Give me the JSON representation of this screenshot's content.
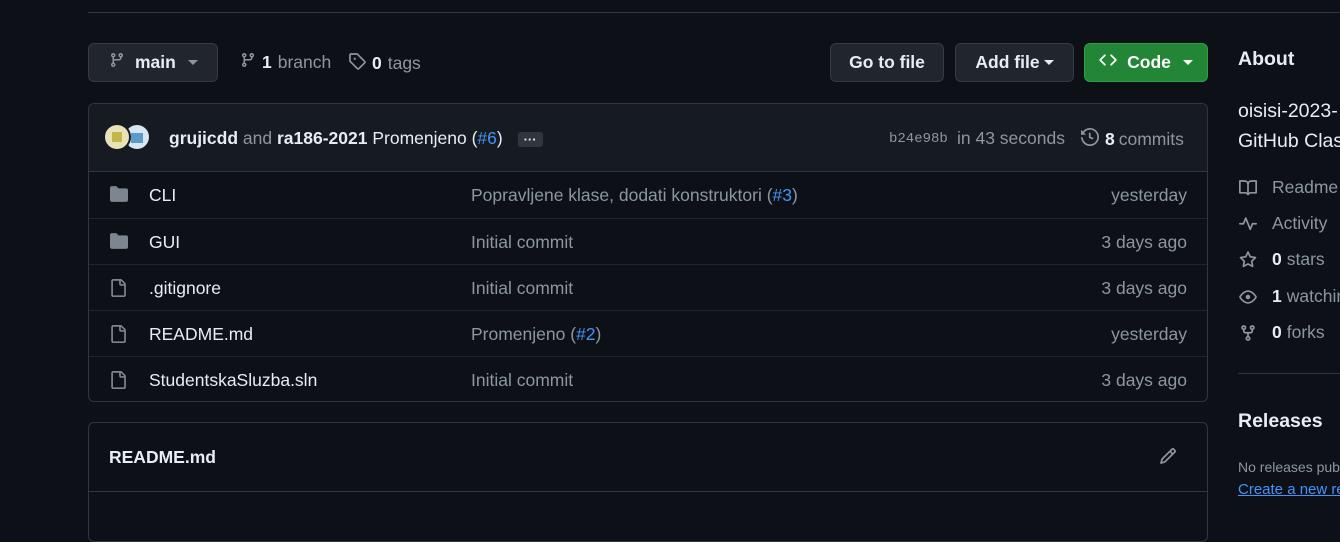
{
  "toolbar": {
    "branch": "main",
    "branches_count": "1",
    "branches_label": "branch",
    "tags_count": "0",
    "tags_label": "tags",
    "go_to_file": "Go to file",
    "add_file": "Add file",
    "code": "Code"
  },
  "commit": {
    "author1": "grujicdd",
    "and": "and",
    "author2": "ra186-2021",
    "message": "Promenjeno (",
    "pr": "#6",
    "message_end": ")",
    "more": "···",
    "sha": "b24e98b",
    "time": "in 43 seconds",
    "commits_count": "8",
    "commits_label": "commits"
  },
  "files": [
    {
      "type": "folder",
      "name": "CLI",
      "message": "Popravljene klase, dodati konstruktori (",
      "ref": "#3",
      "message_end": ")",
      "date": "yesterday"
    },
    {
      "type": "folder",
      "name": "GUI",
      "message": "Initial commit",
      "ref": "",
      "message_end": "",
      "date": "3 days ago"
    },
    {
      "type": "file",
      "name": ".gitignore",
      "message": "Initial commit",
      "ref": "",
      "message_end": "",
      "date": "3 days ago"
    },
    {
      "type": "file",
      "name": "README.md",
      "message": "Promenjeno (",
      "ref": "#2",
      "message_end": ")",
      "date": "yesterday"
    },
    {
      "type": "file",
      "name": "StudentskaSluzba.sln",
      "message": "Initial commit",
      "ref": "",
      "message_end": "",
      "date": "3 days ago"
    }
  ],
  "readme": {
    "title": "README.md"
  },
  "sidebar": {
    "about_heading": "About",
    "description_line1": "oisisi-2023-",
    "description_line2": "GitHub Clas",
    "readme": "Readme",
    "activity": "Activity",
    "stars_count": "0",
    "stars_label": "stars",
    "watching_count": "1",
    "watching_label": "watchin",
    "forks_count": "0",
    "forks_label": "forks",
    "releases_heading": "Releases",
    "no_releases": "No releases pub",
    "create_release": "Create a new re"
  },
  "colors": {
    "background": "#0d1117",
    "code_button": "#238636",
    "link": "#4493f8",
    "muted_text": "#8d96a0"
  }
}
